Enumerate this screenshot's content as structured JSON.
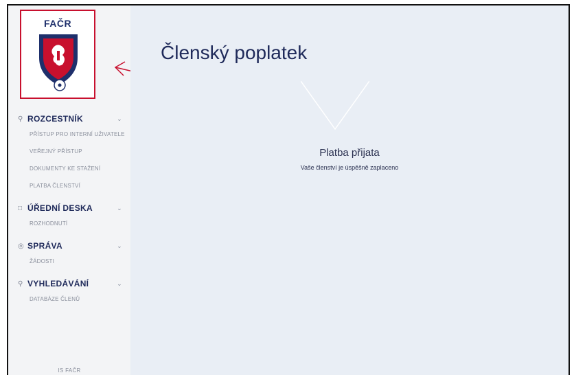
{
  "sidebar": {
    "logo_text": "FAČR",
    "sections": [
      {
        "icon": "user-icon",
        "title": "ROZCESTNÍK",
        "items": [
          "PŘÍSTUP PRO INTERNÍ UŽIVATELE",
          "VEŘEJNÝ PŘÍSTUP",
          "DOKUMENTY KE STAŽENÍ",
          "PLATBA ČLENSTVÍ"
        ]
      },
      {
        "icon": "board-icon",
        "title": "ÚŘEDNÍ DESKA",
        "items": [
          "ROZHODNUTÍ"
        ]
      },
      {
        "icon": "settings-icon",
        "title": "SPRÁVA",
        "items": [
          "ŽÁDOSTI"
        ]
      },
      {
        "icon": "search-icon",
        "title": "VYHLEDÁVÁNÍ",
        "items": [
          "DATABÁZE ČLENŮ"
        ]
      }
    ],
    "footer": "IS FAČR"
  },
  "main": {
    "title": "Členský poplatek",
    "status_title": "Platba přijata",
    "status_message": "Vaše členství je úspěšně zaplaceno"
  },
  "colors": {
    "navy": "#1f2a5a",
    "highlight_red": "#c8102e",
    "main_bg": "#e9eef5",
    "sidebar_bg": "#f3f4f6"
  }
}
